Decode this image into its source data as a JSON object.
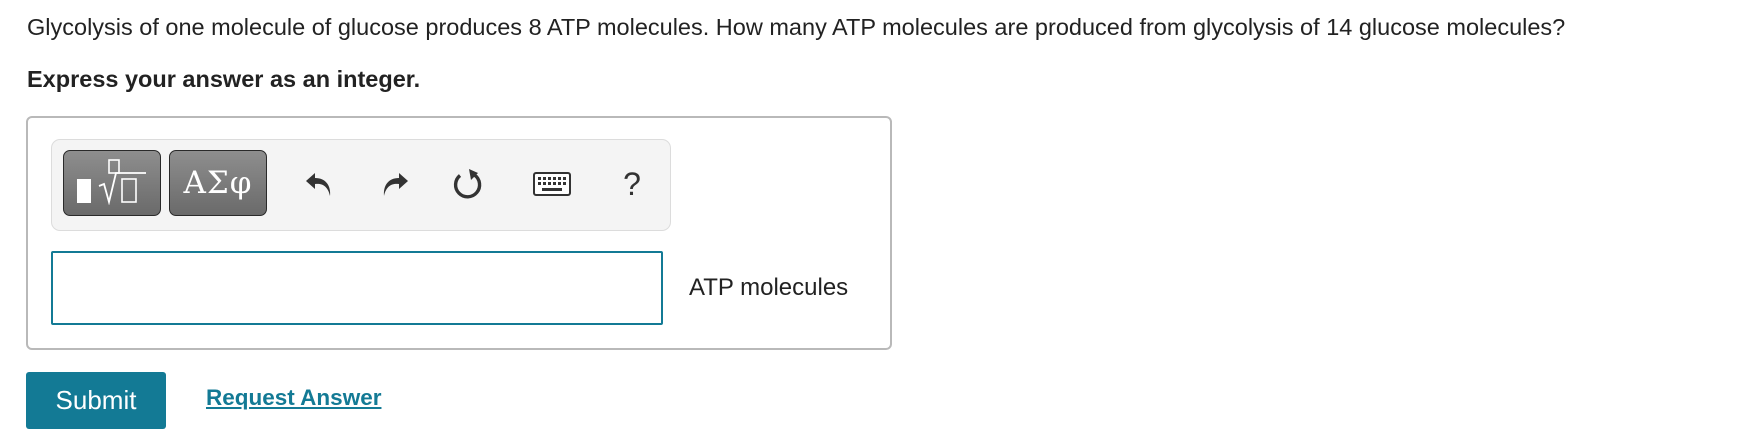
{
  "question": {
    "text": "Glycolysis of one molecule of glucose produces 8 ATP molecules. How many ATP molecules are produced from glycolysis of 14 glucose molecules?",
    "instruction": "Express your answer as an integer."
  },
  "toolbar": {
    "templates_icon": "templates-icon",
    "symbols_label": "ΑΣφ",
    "undo_icon": "undo-icon",
    "redo_icon": "redo-icon",
    "reset_icon": "reset-icon",
    "keyboard_icon": "keyboard-icon",
    "help_label": "?"
  },
  "answer": {
    "value": "",
    "unit": "ATP molecules"
  },
  "actions": {
    "submit_label": "Submit",
    "request_answer_label": "Request Answer"
  },
  "colors": {
    "accent": "#137a95",
    "toolbar_button": "#7a7a7a",
    "toolbar_background": "#f4f4f4"
  }
}
